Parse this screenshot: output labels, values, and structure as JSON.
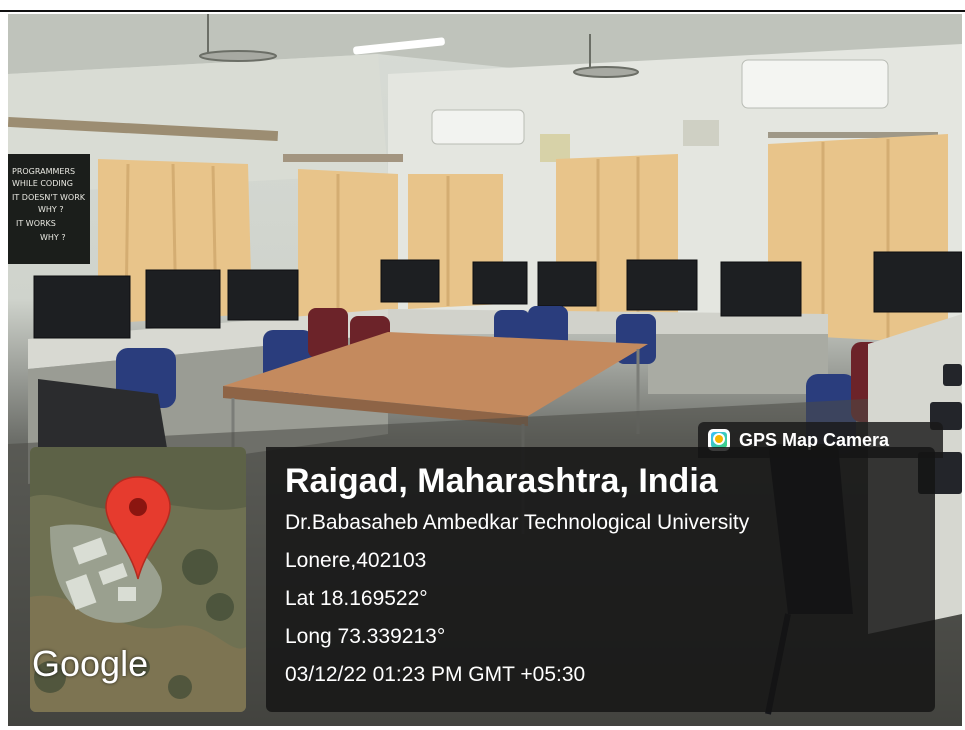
{
  "blackboard": {
    "lines": [
      "PROGRAMMERS",
      "WHILE CODING",
      "IT DOESN'T WORK",
      "WHY ?",
      "IT WORKS",
      "WHY ?"
    ]
  },
  "gps_tag": {
    "label": "GPS Map Camera",
    "icon": "gps-map-camera-app-icon"
  },
  "map": {
    "logo_text": "Google",
    "pin_color": "#e63b2e"
  },
  "info": {
    "place": "Raigad, Maharashtra, India",
    "address": "Dr.Babasaheb Ambedkar Technological University",
    "locality": "Lonere,402103",
    "latitude": "Lat 18.169522°",
    "longitude": "Long 73.339213°",
    "datetime": "03/12/22 01:23 PM GMT +05:30"
  }
}
